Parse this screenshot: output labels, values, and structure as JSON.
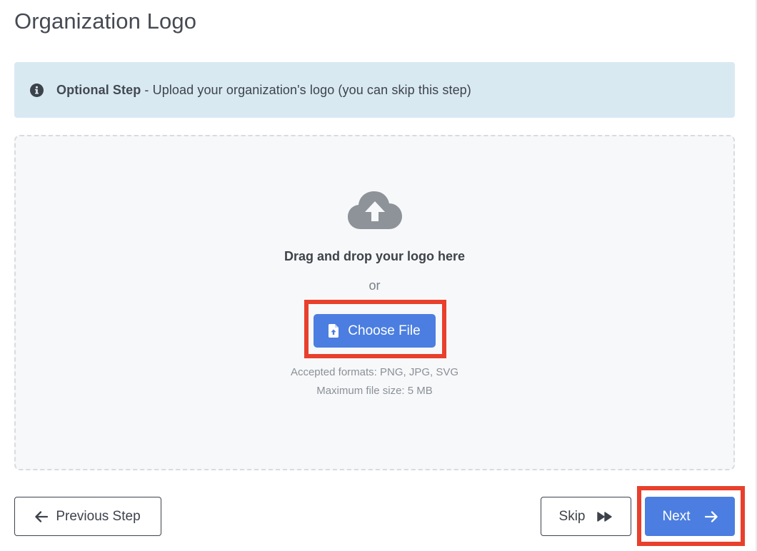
{
  "page": {
    "title": "Organization Logo"
  },
  "alert": {
    "icon": "info-circle-icon",
    "strong": "Optional Step",
    "text": " - Upload your organization's logo (you can skip this step)",
    "background": "#d9e9f2"
  },
  "upload": {
    "icon": "cloud-upload-icon",
    "prompt": "Drag and drop your logo here",
    "or": "or",
    "choose_label": "Choose File",
    "choose_icon": "file-upload-icon",
    "formats": "Accepted formats: PNG, JPG, SVG",
    "max_size": "Maximum file size: 5 MB"
  },
  "footer": {
    "previous_label": "Previous Step",
    "previous_icon": "arrow-left-icon",
    "skip_label": "Skip",
    "skip_icon": "fast-forward-icon",
    "next_label": "Next",
    "next_icon": "arrow-right-icon"
  },
  "colors": {
    "primary": "#4b7ee0",
    "highlight": "#e8402c",
    "text": "#3d424a"
  }
}
